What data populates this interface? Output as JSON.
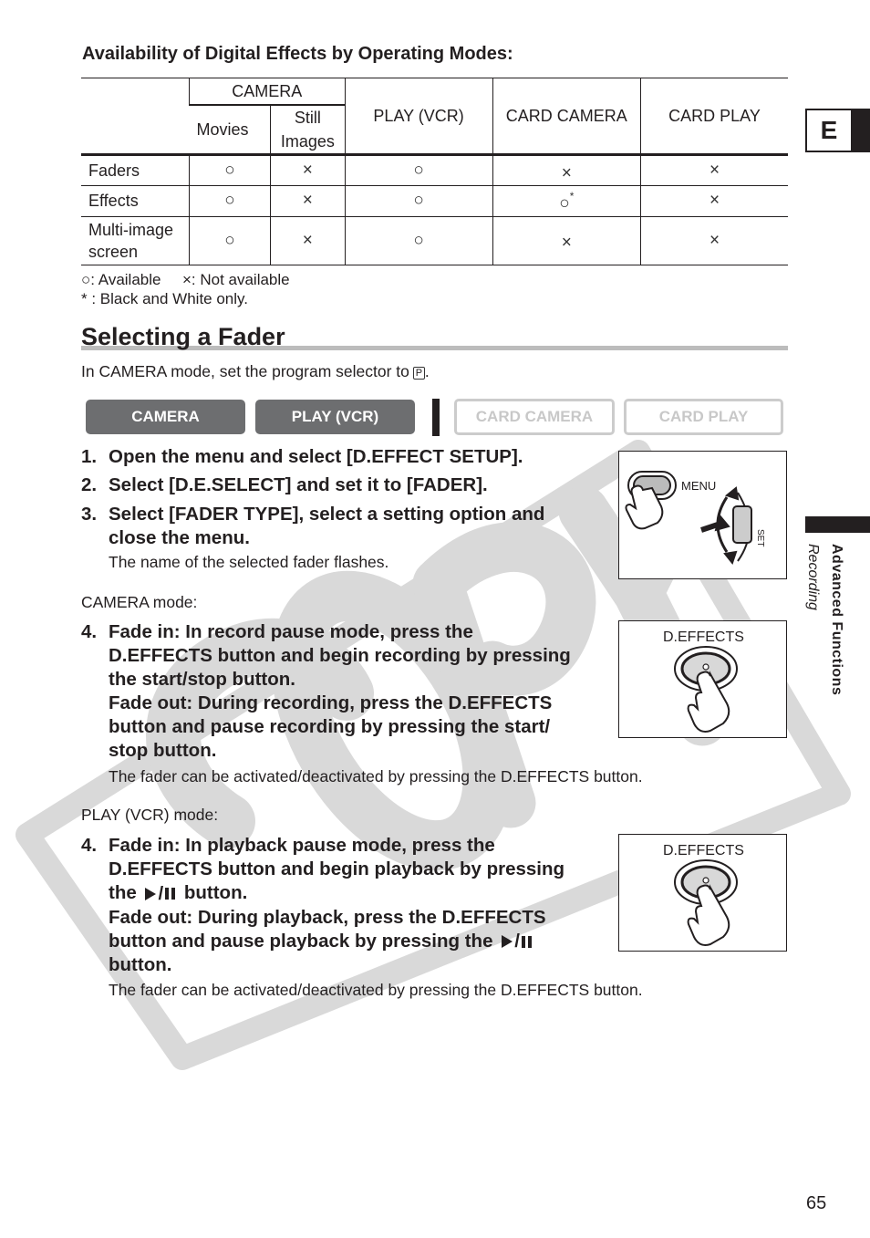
{
  "table": {
    "title": "Availability of Digital Effects by Operating Modes:",
    "header": {
      "camera_group": "CAMERA",
      "movies": "Movies",
      "still_images_line1": "Still",
      "still_images_line2": "Images",
      "play_vcr": "PLAY (VCR)",
      "card_camera": "CARD CAMERA",
      "card_play": "CARD PLAY"
    },
    "rows": [
      {
        "label_line1": "Faders",
        "label_line2": "",
        "movies": "○",
        "still": "×",
        "play_vcr": "○",
        "card_camera": "×",
        "card_camera_note": "",
        "card_play": "×"
      },
      {
        "label_line1": "Effects",
        "label_line2": "",
        "movies": "○",
        "still": "×",
        "play_vcr": "○",
        "card_camera": "○",
        "card_camera_note": "*",
        "card_play": "×"
      },
      {
        "label_line1": "Multi-image",
        "label_line2": "screen",
        "movies": "○",
        "still": "×",
        "play_vcr": "○",
        "card_camera": "×",
        "card_camera_note": "",
        "card_play": "×"
      }
    ],
    "legend": {
      "available_symbol": "○",
      "available_text": ": Available",
      "not_available_symbol": "×",
      "not_available_text": ": Not available",
      "note": "* : Black and White only."
    }
  },
  "section": {
    "title": "Selecting a Fader",
    "intro": "In CAMERA mode, set the program selector to",
    "intro_symbol": "P",
    "intro_end": "."
  },
  "modes": [
    {
      "label": "CAMERA",
      "active": true
    },
    {
      "label": "PLAY (VCR)",
      "active": true
    },
    {
      "label": "CARD CAMERA",
      "active": false
    },
    {
      "label": "CARD PLAY",
      "active": false
    }
  ],
  "steps": {
    "s1_num": "1.",
    "s1": "Open the menu and select [D.EFFECT SETUP].",
    "s2_num": "2.",
    "s2": "Select [D.E.SELECT] and set it to [FADER].",
    "s3_num": "3.",
    "s3_line1": "Select [FADER TYPE], select a setting option and",
    "s3_line2": "close the menu.",
    "s3_note": "The name of the selected fader flashes.",
    "camera_mode_label": "CAMERA mode:",
    "cam4_num": "4.",
    "cam4_lines": [
      "Fade in: In record pause mode, press the",
      "D.EFFECTS button and begin recording by pressing",
      "the start/stop button.",
      "Fade out: During recording, press the D.EFFECTS",
      "button and pause recording by pressing the start/",
      "stop button."
    ],
    "cam4_note": "The fader can be activated/deactivated by pressing the D.EFFECTS button.",
    "play_mode_label": "PLAY (VCR) mode:",
    "play4_num": "4.",
    "play4_line1": "Fade in: In playback pause mode, press the",
    "play4_line2": "D.EFFECTS button and begin playback by pressing",
    "play4_line3a": "the",
    "play4_line3b": "button.",
    "play4_line4": "Fade out: During playback, press the D.EFFECTS",
    "play4_line5a": "button and pause playback by pressing the",
    "play4_line6": "button.",
    "play4_note": "The fader can be activated/deactivated by pressing the D.EFFECTS button."
  },
  "illustrations": {
    "menu_label": "MENU",
    "set_label": "SET",
    "deffects_label": "D.EFFECTS"
  },
  "sidebar": {
    "tab_letter": "E",
    "chapter": "Advanced Functions",
    "subchapter": "Recording"
  },
  "watermark": "COPY",
  "page_number": "65"
}
